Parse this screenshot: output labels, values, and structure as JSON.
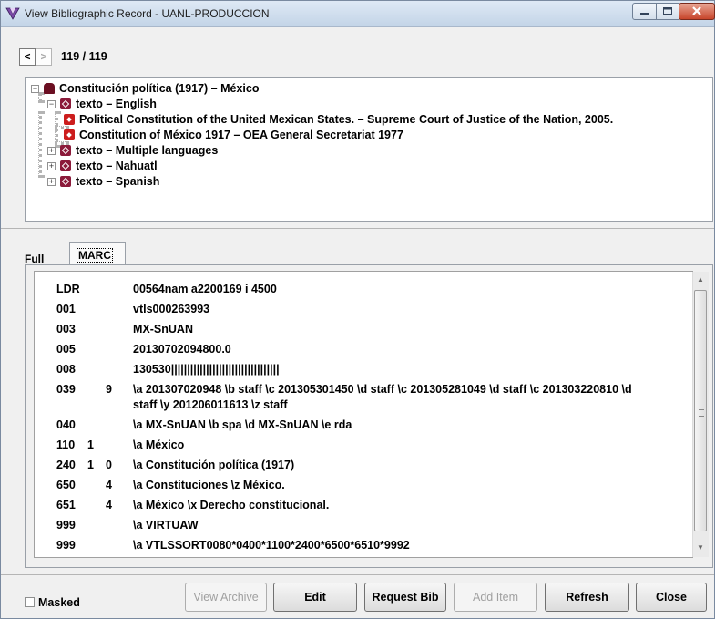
{
  "window": {
    "title": "View Bibliographic Record - UANL-PRODUCCION"
  },
  "nav": {
    "prev": "<",
    "next": ">",
    "counter": "119 / 119"
  },
  "tree": {
    "root": "Constitución política (1917) – México",
    "items": [
      {
        "label": "texto – English",
        "expander": "−"
      },
      {
        "label": "Political Constitution of the United Mexican States. – Supreme Court of Justice of the Nation, 2005."
      },
      {
        "label": "Constitution of México 1917 – OEA General Secretariat 1977"
      },
      {
        "label": "texto – Multiple languages",
        "expander": "+"
      },
      {
        "label": "texto – Nahuatl",
        "expander": "+"
      },
      {
        "label": "texto – Spanish",
        "expander": "+"
      }
    ],
    "root_expander": "−"
  },
  "tabs": {
    "full": "Full",
    "marc": "MARC"
  },
  "marc": {
    "rows": [
      {
        "tag": "LDR",
        "ind1": "",
        "ind2": "",
        "value": "00564nam a2200169 i 4500"
      },
      {
        "tag": "001",
        "ind1": "",
        "ind2": "",
        "value": "vtls000263993"
      },
      {
        "tag": "003",
        "ind1": "",
        "ind2": "",
        "value": "MX-SnUAN"
      },
      {
        "tag": "005",
        "ind1": "",
        "ind2": "",
        "value": "20130702094800.0"
      },
      {
        "tag": "008",
        "ind1": "",
        "ind2": "",
        "value": "130530||||||||||||||||||||||||||||||||||"
      },
      {
        "tag": "039",
        "ind1": "",
        "ind2": "9",
        "value": "\\a 201307020948 \\b staff \\c 201305301450 \\d staff \\c 201305281049 \\d staff \\c 201303220810 \\d staff \\y 201206011613 \\z staff"
      },
      {
        "tag": "040",
        "ind1": "",
        "ind2": "",
        "value": "\\a MX-SnUAN \\b spa \\d MX-SnUAN \\e rda"
      },
      {
        "tag": "110",
        "ind1": "1",
        "ind2": "",
        "value": "\\a México"
      },
      {
        "tag": "240",
        "ind1": "1",
        "ind2": "0",
        "value": "\\a Constitución política (1917)"
      },
      {
        "tag": "650",
        "ind1": "",
        "ind2": "4",
        "value": "\\a Constituciones \\z México."
      },
      {
        "tag": "651",
        "ind1": "",
        "ind2": "4",
        "value": "\\a México \\x Derecho constitucional."
      },
      {
        "tag": "999",
        "ind1": "",
        "ind2": "",
        "value": "\\a VIRTUAW"
      },
      {
        "tag": "999",
        "ind1": "",
        "ind2": "",
        "value": "\\a VTLSSORT0080*0400*1100*2400*6500*6510*9992"
      }
    ]
  },
  "footer": {
    "masked_label": "Masked",
    "buttons": {
      "view_archive": "View Archive",
      "edit": "Edit",
      "request_bib": "Request Bib",
      "add_item": "Add Item",
      "refresh": "Refresh",
      "close": "Close"
    }
  }
}
